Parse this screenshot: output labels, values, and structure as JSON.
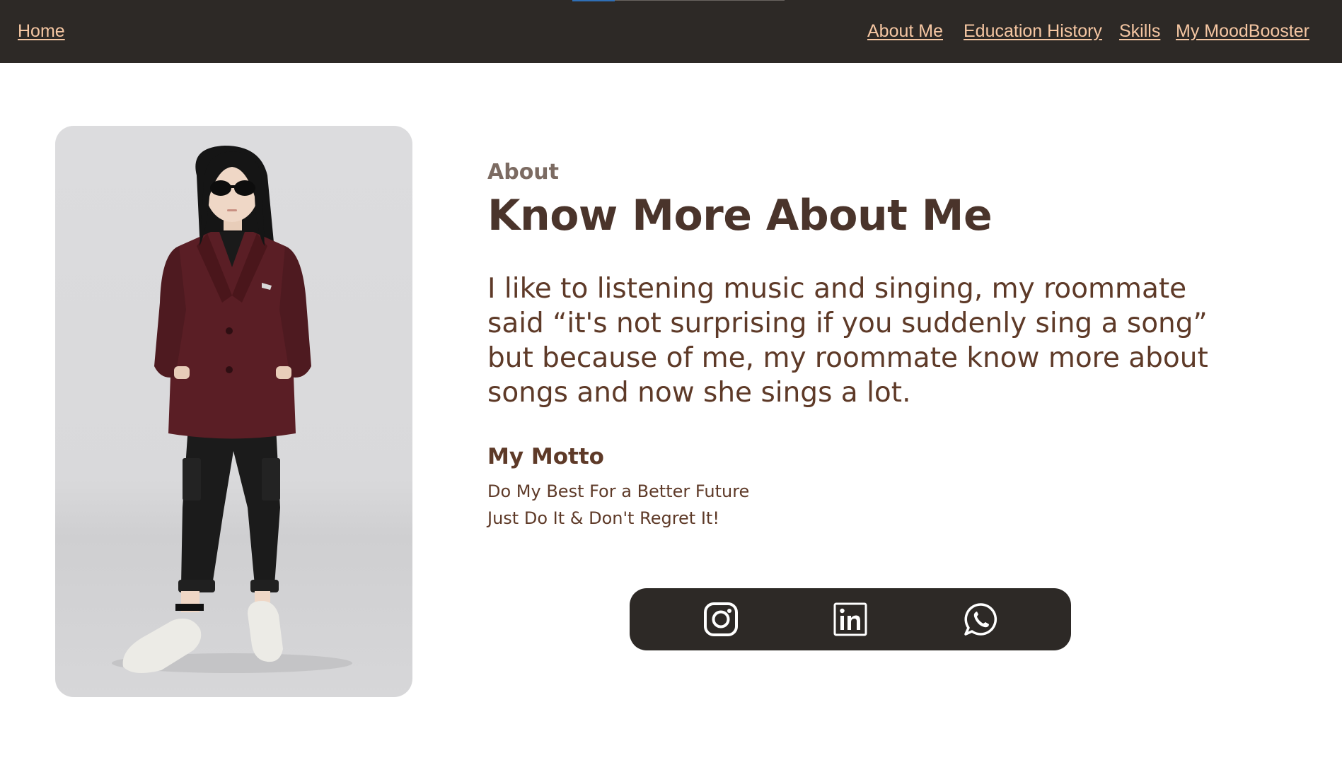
{
  "nav": {
    "home": "Home",
    "links": [
      "About Me",
      "Education History",
      "Skills",
      "My MoodBooster"
    ]
  },
  "about": {
    "label": "About",
    "heading": "Know More About Me",
    "bio": "I like to listening music and singing, my roommate said “it's not surprising if you suddenly sing a song” but because of me, my roommate know more about songs and now she sings a lot.",
    "motto_title": "My Motto",
    "motto_lines": [
      "Do My Best For a Better Future",
      "Just Do It & Don't Regret It!"
    ]
  },
  "social": {
    "icons": [
      "instagram-icon",
      "linkedin-icon",
      "whatsapp-icon"
    ]
  },
  "colors": {
    "nav_bg": "#2d2926",
    "nav_link": "#f6c7a3",
    "heading": "#4a342b",
    "text": "#5e3a28",
    "jacket": "#5a1e25"
  }
}
